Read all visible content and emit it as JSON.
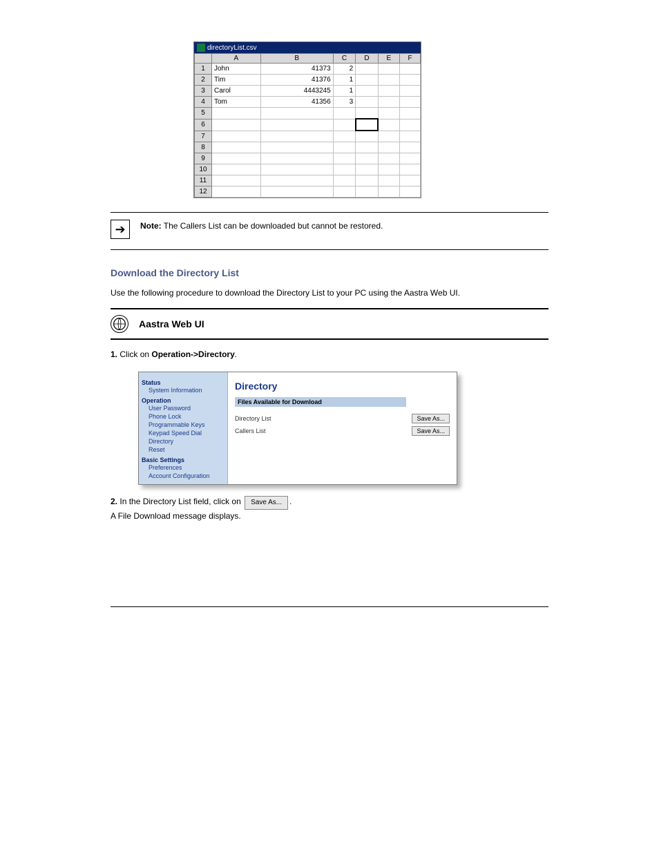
{
  "spreadsheet": {
    "filename": "directoryList.csv",
    "columns": [
      "A",
      "B",
      "C",
      "D",
      "E",
      "F"
    ],
    "rows": [
      {
        "num": "1",
        "name": "John",
        "ext": "41373",
        "line": "2"
      },
      {
        "num": "2",
        "name": "Tim",
        "ext": "41376",
        "line": "1"
      },
      {
        "num": "3",
        "name": "Carol",
        "ext": "4443245",
        "line": "1"
      },
      {
        "num": "4",
        "name": "Tom",
        "ext": "41356",
        "line": "3"
      },
      {
        "num": "5",
        "name": "",
        "ext": "",
        "line": ""
      },
      {
        "num": "6",
        "name": "",
        "ext": "",
        "line": ""
      },
      {
        "num": "7",
        "name": "",
        "ext": "",
        "line": ""
      },
      {
        "num": "8",
        "name": "",
        "ext": "",
        "line": ""
      },
      {
        "num": "9",
        "name": "",
        "ext": "",
        "line": ""
      },
      {
        "num": "10",
        "name": "",
        "ext": "",
        "line": ""
      },
      {
        "num": "11",
        "name": "",
        "ext": "",
        "line": ""
      },
      {
        "num": "12",
        "name": "",
        "ext": "",
        "line": ""
      }
    ]
  },
  "note": {
    "label": "Note:",
    "text": "The Callers List can be downloaded but cannot be restored."
  },
  "download_heading": "Download the Directory List",
  "download_intro_prefix": "Use the following procedure to download the Directory List to your PC using the Aastra Web",
  "download_intro_suffix": " UI.",
  "ui_label": "Aastra Web UI",
  "step1_prefix": "1.",
  "step1_text": "Click on ",
  "step1_path": "Operation->Directory",
  "step1_suffix": ".",
  "webui": {
    "sidebar": {
      "status": "Status",
      "sysinfo": "System Information",
      "operation": "Operation",
      "userpw": "User Password",
      "phonelock": "Phone Lock",
      "progkeys": "Programmable Keys",
      "speeddial": "Keypad Speed Dial",
      "directory": "Directory",
      "reset": "Reset",
      "basic": "Basic Settings",
      "prefs": "Preferences",
      "account": "Account Configuration"
    },
    "main": {
      "title": "Directory",
      "subheader": "Files Available for Download",
      "row1_label": "Directory List",
      "row2_label": "Callers List",
      "save_btn": "Save As..."
    }
  },
  "step2_prefix": "2.",
  "step2_a": "In the Directory List field, click on ",
  "step2_b": "A File Download message displays.",
  "btn_saveas": "Save As...",
  "footer_left": "",
  "footer_right": ""
}
